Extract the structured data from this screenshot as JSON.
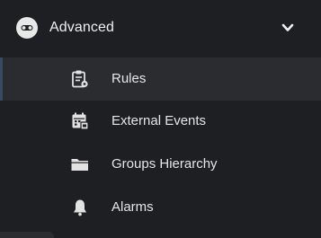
{
  "section": {
    "label": "Advanced",
    "icon": "advanced-toggle-icon",
    "expanded": true,
    "chevron_icon": "chevron-down-icon"
  },
  "items": [
    {
      "label": "Rules",
      "icon": "clipboard-gear-icon",
      "active": true
    },
    {
      "label": "External Events",
      "icon": "calendar-events-icon",
      "active": false
    },
    {
      "label": "Groups Hierarchy",
      "icon": "folder-icon",
      "active": false
    },
    {
      "label": "Alarms",
      "icon": "bell-icon",
      "active": false
    }
  ],
  "colors": {
    "background": "#1d1f22",
    "active_item": "#2a2c30",
    "text": "#e6e6e6",
    "icon": "#e2e2e2"
  }
}
